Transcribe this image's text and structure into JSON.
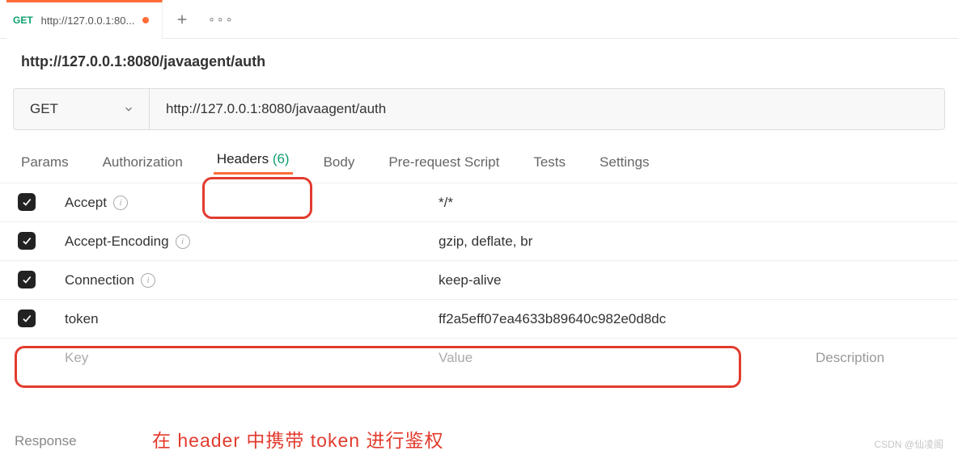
{
  "tabbar": {
    "method": "GET",
    "title": "http://127.0.0.1:80...",
    "plus_tooltip": "New Tab"
  },
  "breadcrumb": "http://127.0.0.1:8080/javaagent/auth",
  "request": {
    "method": "GET",
    "url": "http://127.0.0.1:8080/javaagent/auth"
  },
  "tabs": {
    "params": "Params",
    "authorization": "Authorization",
    "headers_label": "Headers",
    "headers_count": "(6)",
    "body": "Body",
    "prerequest": "Pre-request Script",
    "tests": "Tests",
    "settings": "Settings"
  },
  "header_rows": [
    {
      "key": "Accept",
      "value": "*/*",
      "info": true
    },
    {
      "key": "Accept-Encoding",
      "value": "gzip, deflate, br",
      "info": true
    },
    {
      "key": "Connection",
      "value": "keep-alive",
      "info": true
    },
    {
      "key": "token",
      "value": "ff2a5eff07ea4633b89640c982e0d8dc",
      "info": false
    }
  ],
  "placeholder": {
    "key": "Key",
    "value": "Value",
    "desc": "Description"
  },
  "response_label": "Response",
  "annotation": "在 header 中携带 token 进行鉴权",
  "watermark": "CSDN @仙凌阁"
}
